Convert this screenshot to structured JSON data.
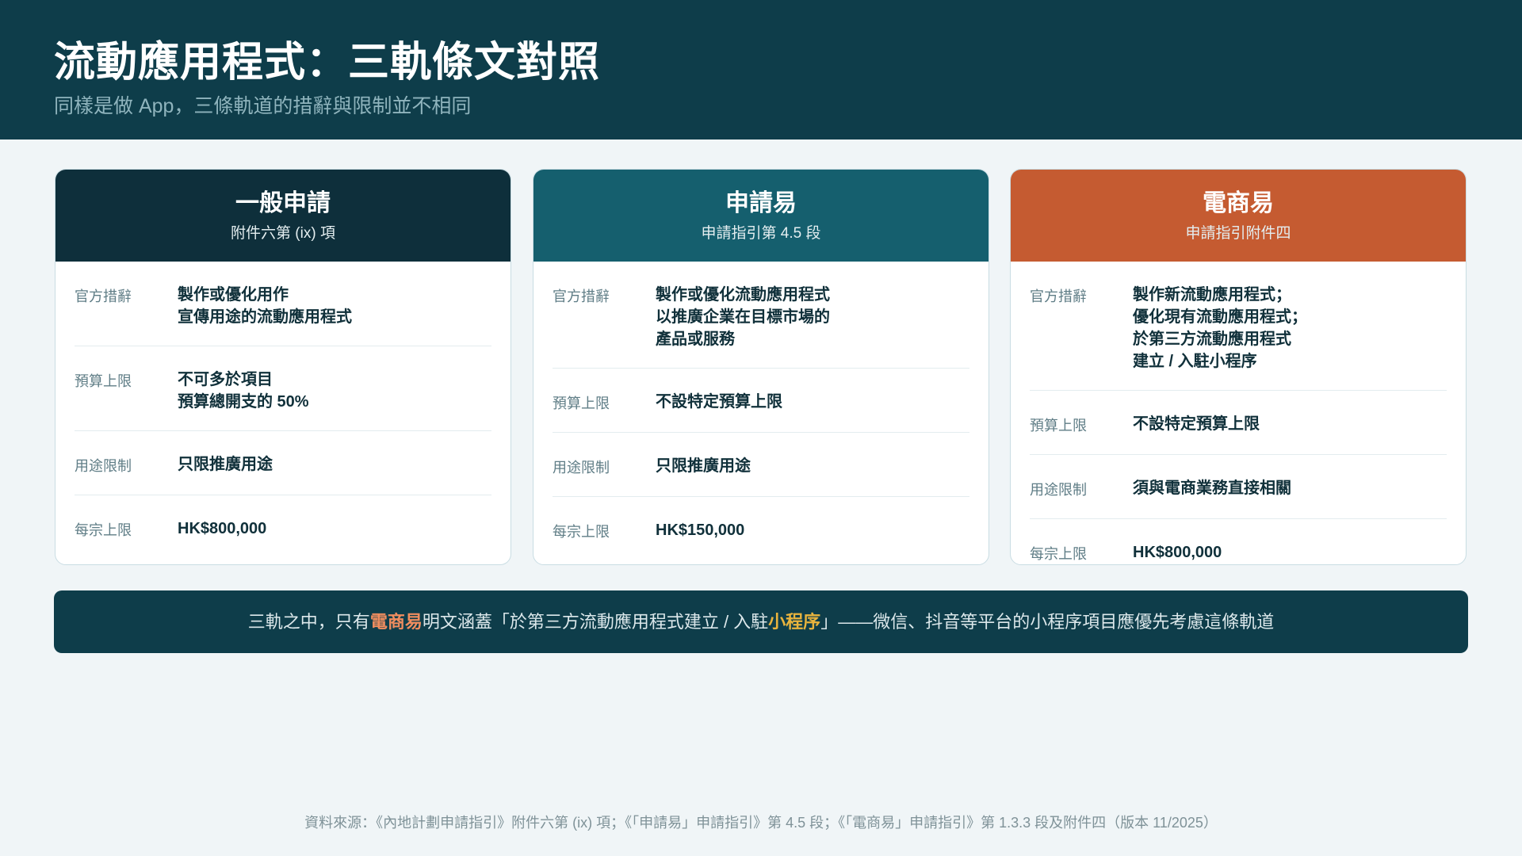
{
  "header": {
    "title": "流動應用程式：三軌條文對照",
    "subtitle": "同樣是做 App，三條軌道的措辭與限制並不相同"
  },
  "colors": {
    "header_bg": "#0e3d4a",
    "card1_head": "#0e2f3b",
    "card2_head": "#155f6e",
    "card3_head": "#c55b31",
    "highlight_orange": "#f08d5f",
    "highlight_gold": "#e9b43d"
  },
  "cards": [
    {
      "title": "一般申請",
      "ref": "附件六第 (ix) 項",
      "rows": [
        {
          "label": "官方措辭",
          "value": "製作或優化用作\n宣傳用途的流動應用程式"
        },
        {
          "label": "預算上限",
          "value": "不可多於項目\n預算總開支的 50%"
        },
        {
          "label": "用途限制",
          "value": "只限推廣用途"
        },
        {
          "label": "每宗上限",
          "value": "HK$800,000"
        }
      ]
    },
    {
      "title": "申請易",
      "ref": "申請指引第 4.5 段",
      "rows": [
        {
          "label": "官方措辭",
          "value": "製作或優化流動應用程式\n以推廣企業在目標市場的\n產品或服務"
        },
        {
          "label": "預算上限",
          "value": "不設特定預算上限"
        },
        {
          "label": "用途限制",
          "value": "只限推廣用途"
        },
        {
          "label": "每宗上限",
          "value": "HK$150,000"
        }
      ]
    },
    {
      "title": "電商易",
      "ref": "申請指引附件四",
      "rows": [
        {
          "label": "官方措辭",
          "value": "製作新流動應用程式；\n優化現有流動應用程式；\n於第三方流動應用程式\n建立 / 入駐小程序"
        },
        {
          "label": "預算上限",
          "value": "不設特定預算上限"
        },
        {
          "label": "用途限制",
          "value": "須與電商業務直接相關"
        },
        {
          "label": "每宗上限",
          "value": "HK$800,000"
        }
      ]
    }
  ],
  "banner": {
    "part1": "三軌之中，只有",
    "highlight1": "電商易",
    "part2": "明文涵蓋「於第三方流動應用程式建立 / 入駐",
    "highlight2": "小程序",
    "part3": "」——微信、抖音等平台的小程序項目應優先考慮這條軌道"
  },
  "footnote": "資料來源：《內地計劃申請指引》附件六第 (ix) 項；《「申請易」申請指引》第 4.5 段；《「電商易」申請指引》第 1.3.3 段及附件四（版本 11/2025）"
}
